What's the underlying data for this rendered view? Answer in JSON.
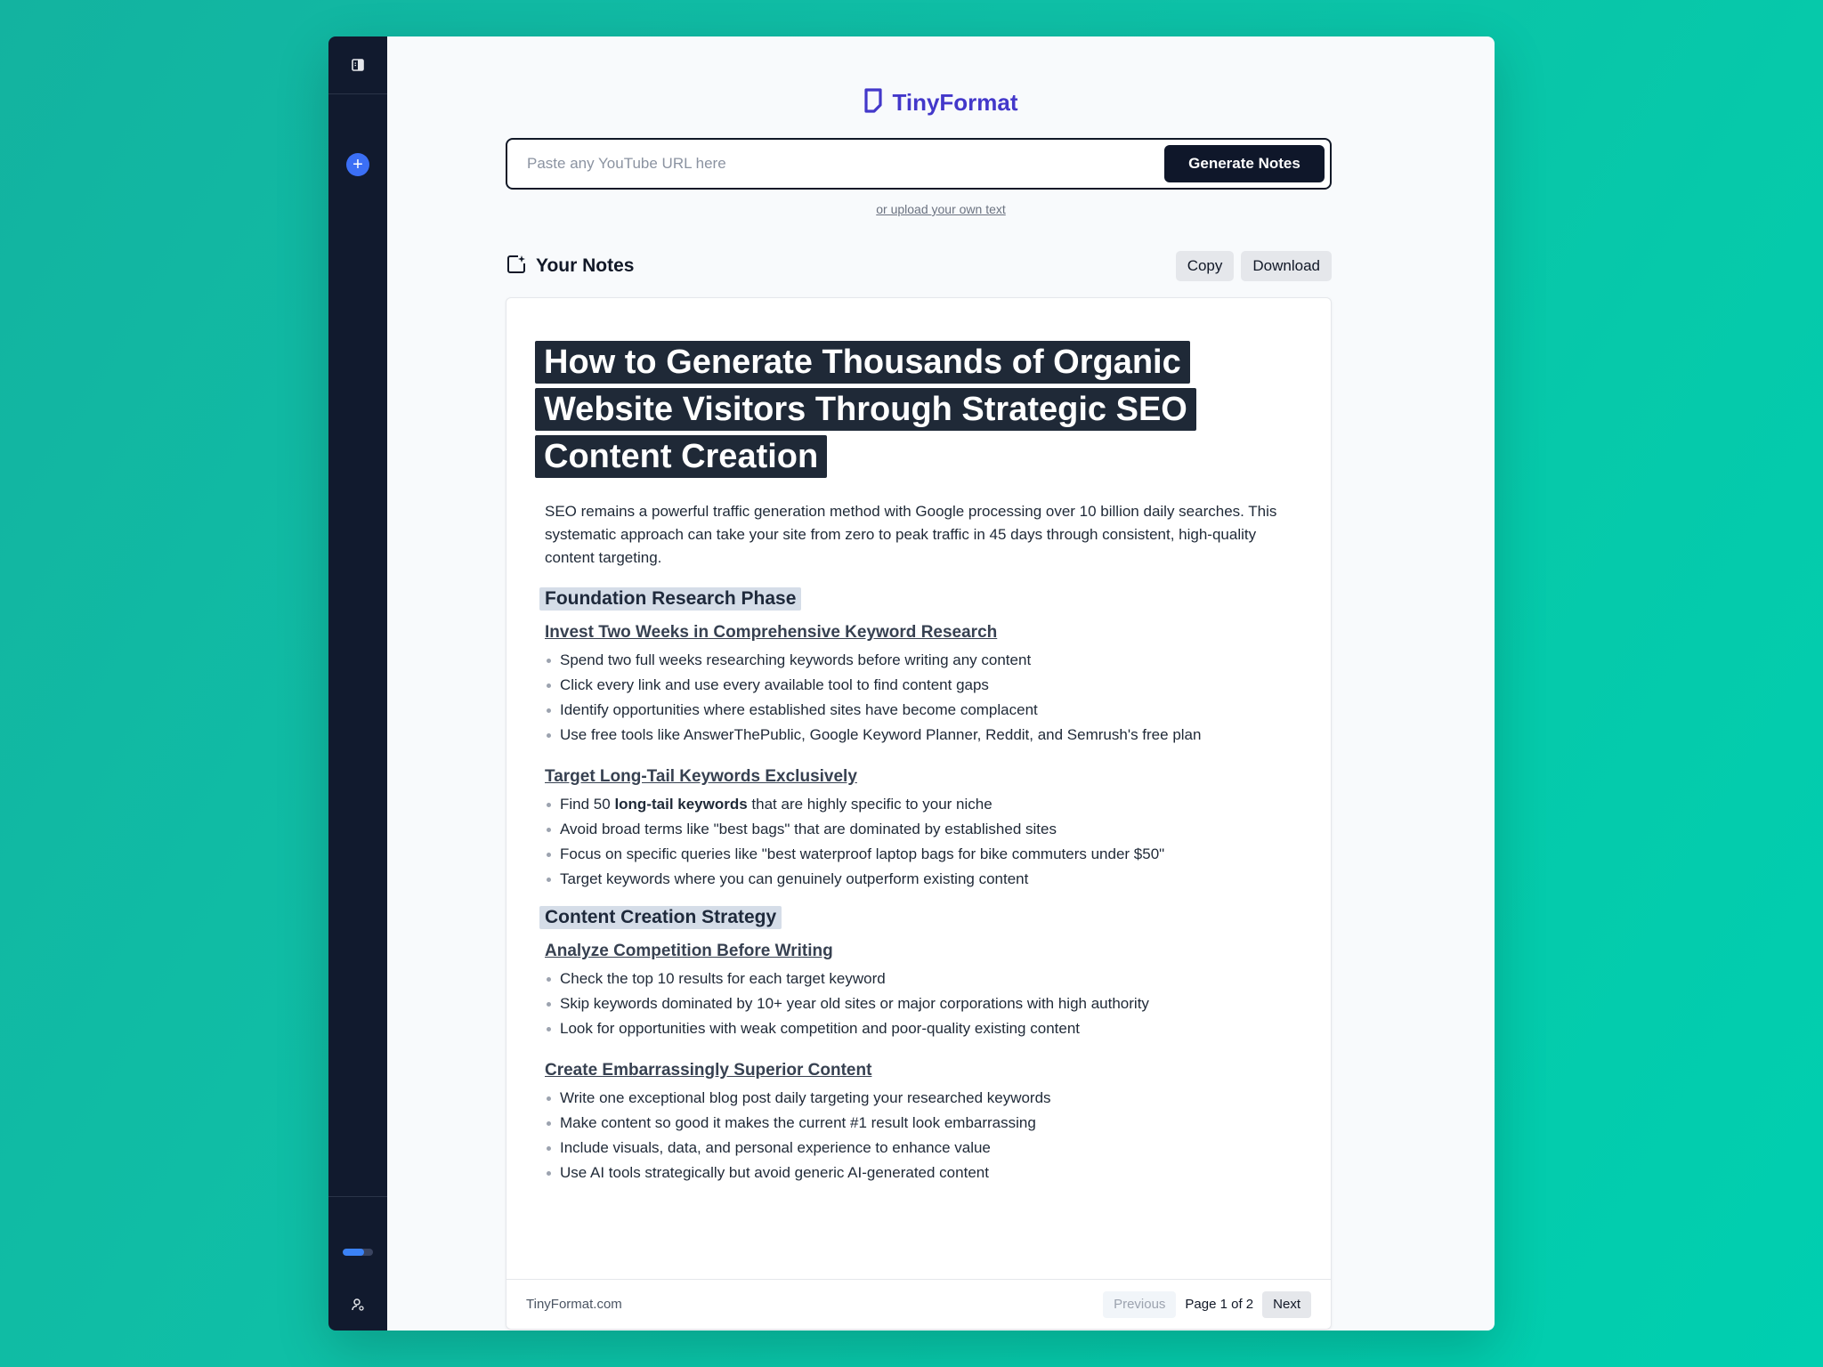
{
  "brand": {
    "name": "TinyFormat"
  },
  "search": {
    "placeholder": "Paste any YouTube URL here",
    "value": "",
    "generate_label": "Generate Notes",
    "upload_link": "or upload your own text"
  },
  "notes": {
    "heading": "Your Notes",
    "copy_label": "Copy",
    "download_label": "Download"
  },
  "sidebar": {
    "progress_fraction": 0.7,
    "icons": [
      "sidebar-toggle-icon",
      "plus-icon",
      "user-icon",
      "logout-icon"
    ]
  },
  "document": {
    "title": "How to Generate Thousands of Organic Website Visitors Through Strategic SEO Content Creation",
    "intro": "SEO remains a powerful traffic generation method with Google processing over 10 billion daily searches. This systematic approach can take your site from zero to peak traffic in 45 days through consistent, high-quality content targeting.",
    "sections": [
      {
        "heading": "Foundation Research Phase",
        "subsections": [
          {
            "heading": "Invest Two Weeks in Comprehensive Keyword Research",
            "items": [
              "Spend two full weeks researching keywords before writing any content",
              "Click every link and use every available tool to find content gaps",
              "Identify opportunities where established sites have become complacent",
              "Use free tools like AnswerThePublic, Google Keyword Planner, Reddit, and Semrush's free plan"
            ]
          },
          {
            "heading": "Target Long-Tail Keywords Exclusively",
            "item0": {
              "before": "Find 50 ",
              "bold": "long-tail keywords",
              "after": " that are highly specific to your niche"
            },
            "items": [
              "Avoid broad terms like \"best bags\" that are dominated by established sites",
              "Focus on specific queries like \"best waterproof laptop bags for bike commuters under $50\"",
              "Target keywords where you can genuinely outperform existing content"
            ]
          }
        ]
      },
      {
        "heading": "Content Creation Strategy",
        "subsections": [
          {
            "heading": "Analyze Competition Before Writing",
            "items": [
              "Check the top 10 results for each target keyword",
              "Skip keywords dominated by 10+ year old sites or major corporations with high authority",
              "Look for opportunities with weak competition and poor-quality existing content"
            ]
          },
          {
            "heading": "Create Embarrassingly Superior Content",
            "items": [
              "Write one exceptional blog post daily targeting your researched keywords",
              "Make content so good it makes the current #1 result look embarrassing",
              "Include visuals, data, and personal experience to enhance value",
              "Use AI tools strategically but avoid generic AI-generated content"
            ]
          }
        ]
      }
    ]
  },
  "footer": {
    "site": "TinyFormat.com",
    "prev_label": "Previous",
    "page_info": "Page 1 of 2",
    "next_label": "Next"
  },
  "colors": {
    "background": "#0fbfa6",
    "sidebar": "#111a2e",
    "brand": "#4338ca",
    "accent": "#3b6ff5"
  }
}
